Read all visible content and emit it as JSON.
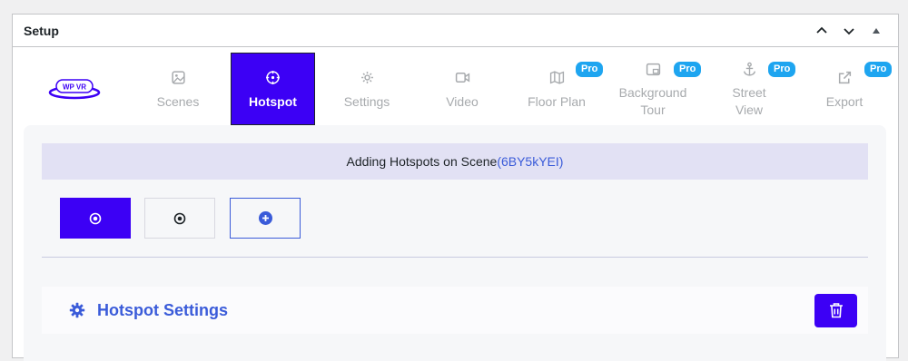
{
  "panel": {
    "title": "Setup",
    "controls": [
      "chevron-up",
      "chevron-down",
      "caret-up"
    ]
  },
  "logo": {
    "text": "WP VR"
  },
  "tabs": [
    {
      "label": "Scenes",
      "icon": "image-icon",
      "active": false,
      "pro": false
    },
    {
      "label": "Hotspot",
      "icon": "crosshair-icon",
      "active": true,
      "pro": false
    },
    {
      "label": "Settings",
      "icon": "gear-icon",
      "active": false,
      "pro": false
    },
    {
      "label": "Video",
      "icon": "video-icon",
      "active": false,
      "pro": false
    },
    {
      "label": "Floor Plan",
      "icon": "map-icon",
      "active": false,
      "pro": true
    },
    {
      "label": "Background Tour",
      "icon": "picture-in-picture-icon",
      "active": false,
      "pro": true
    },
    {
      "label": "Street View",
      "icon": "anchor-icon",
      "active": false,
      "pro": true
    },
    {
      "label": "Export",
      "icon": "external-link-icon",
      "active": false,
      "pro": true
    }
  ],
  "pro_badge": "Pro",
  "banner": {
    "prefix": "Adding Hotspots on Scene",
    "scene_id": "(6BY5kYEI)"
  },
  "hotspot_buttons": [
    {
      "name": "hotspot-1",
      "selected": true
    },
    {
      "name": "hotspot-2",
      "selected": false
    },
    {
      "name": "add-hotspot",
      "selected": false
    }
  ],
  "hotspot_settings": {
    "title": "Hotspot Settings"
  },
  "colors": {
    "accent": "#3c00f5",
    "link_blue": "#3a5bd9",
    "pro_badge": "#1ea5f0",
    "muted_tab": "#a7aaad",
    "banner_bg": "#e2e1f4"
  }
}
